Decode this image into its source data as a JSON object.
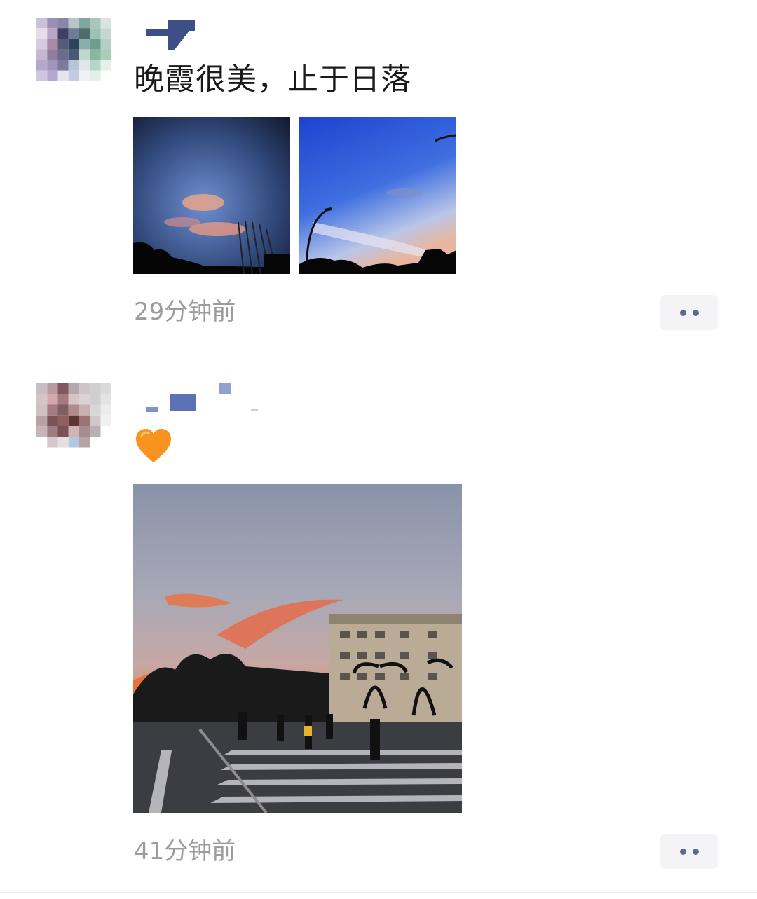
{
  "posts": [
    {
      "text": "晚霞很美，止于日落",
      "time": "29分钟前",
      "images": [
        {
          "description_icon": "sunset-sky-photo-1"
        },
        {
          "description_icon": "sunset-sky-photo-2"
        }
      ],
      "more_icon": "more-dots-icon"
    },
    {
      "emoji": "🧡",
      "time": "41分钟前",
      "images": [
        {
          "description_icon": "sunset-crosswalk-photo"
        }
      ],
      "more_icon": "more-dots-icon"
    }
  ],
  "colors": {
    "link_blue": "#576b95",
    "time_gray": "#9c9c9c",
    "text": "#1a1a1a",
    "button_bg": "#f4f4f6"
  }
}
